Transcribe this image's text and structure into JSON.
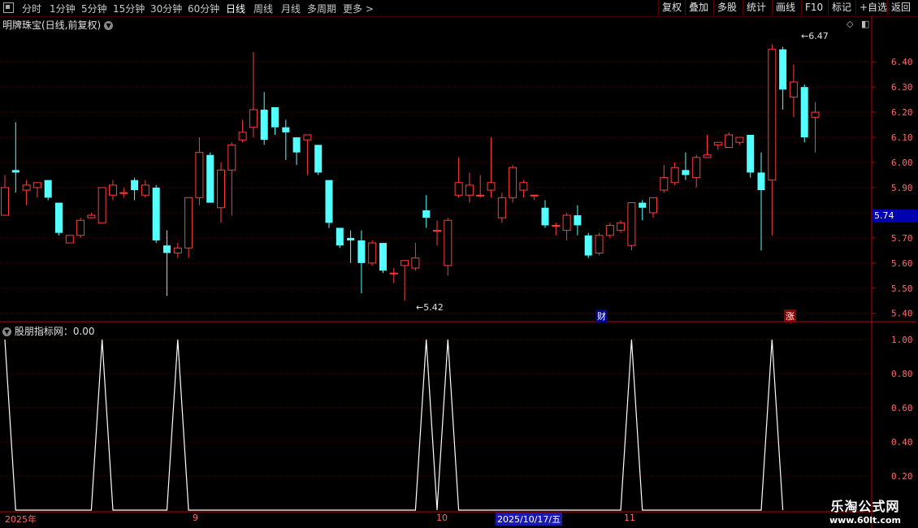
{
  "toolbar": {
    "periods": [
      "分时",
      "1分钟",
      "5分钟",
      "15分钟",
      "30分钟",
      "60分钟",
      "日线",
      "周线",
      "月线",
      "多周期",
      "更多 >"
    ],
    "active_period": "日线",
    "buttons": [
      "复权",
      "叠加",
      "多股",
      "统计",
      "画线",
      "F10",
      "标记",
      "+自选",
      "返回"
    ]
  },
  "main_chart": {
    "title": "明牌珠宝(日线,前复权)",
    "current_price_tag": "5.74",
    "high_annotation": "6.47",
    "low_annotation": "5.42",
    "tags": {
      "cai": "财",
      "zhang": "涨"
    },
    "y_ticks": [
      "6.40",
      "6.30",
      "6.20",
      "6.10",
      "6.00",
      "5.90",
      "5.80",
      "5.70",
      "5.60",
      "5.50",
      "5.40"
    ]
  },
  "indicator": {
    "title": "股朋指标网：0.00",
    "y_ticks": [
      "1.00",
      "0.80",
      "0.60",
      "0.40",
      "0.20"
    ]
  },
  "date_axis": {
    "labels": [
      "2025年",
      "9",
      "10",
      "11"
    ],
    "cursor": "2025/10/17/五"
  },
  "watermark": {
    "line1": "乐淘公式网",
    "line2": "www.60lt.com"
  },
  "colors": {
    "up": "#ff3c3c",
    "down": "#54ffff",
    "grid": "#5a0000",
    "axis": "#c00000"
  },
  "chart_data": {
    "type": "candlestick",
    "ylim": [
      5.37,
      6.53
    ],
    "candles": [
      [
        5.79,
        5.9,
        5.95,
        5.79
      ],
      [
        5.97,
        5.96,
        6.16,
        5.88
      ],
      [
        5.89,
        5.91,
        5.93,
        5.83
      ],
      [
        5.9,
        5.92,
        5.92,
        5.86
      ],
      [
        5.93,
        5.86,
        5.93,
        5.85
      ],
      [
        5.84,
        5.72,
        5.84,
        5.71
      ],
      [
        5.68,
        5.71,
        5.71,
        5.68
      ],
      [
        5.71,
        5.77,
        5.78,
        5.7
      ],
      [
        5.78,
        5.79,
        5.8,
        5.78
      ],
      [
        5.76,
        5.9,
        5.9,
        5.76
      ],
      [
        5.87,
        5.91,
        5.93,
        5.85
      ],
      [
        5.88,
        5.88,
        5.9,
        5.86
      ],
      [
        5.93,
        5.89,
        5.94,
        5.85
      ],
      [
        5.87,
        5.91,
        5.93,
        5.86
      ],
      [
        5.9,
        5.69,
        5.91,
        5.68
      ],
      [
        5.67,
        5.64,
        5.73,
        5.47
      ],
      [
        5.64,
        5.66,
        5.68,
        5.62
      ],
      [
        5.66,
        5.86,
        5.86,
        5.62
      ],
      [
        5.86,
        6.04,
        6.1,
        5.83
      ],
      [
        6.03,
        5.84,
        6.04,
        5.84
      ],
      [
        5.82,
        5.97,
        6.0,
        5.76
      ],
      [
        5.97,
        6.07,
        6.08,
        5.79
      ],
      [
        6.09,
        6.12,
        6.17,
        6.08
      ],
      [
        6.14,
        6.21,
        6.44,
        6.1
      ],
      [
        6.21,
        6.09,
        6.28,
        6.07
      ],
      [
        6.22,
        6.14,
        6.22,
        6.11
      ],
      [
        6.14,
        6.12,
        6.17,
        6.01
      ],
      [
        6.1,
        6.04,
        6.1,
        5.99
      ],
      [
        6.09,
        6.11,
        6.11,
        5.95
      ],
      [
        6.07,
        5.96,
        6.07,
        5.95
      ],
      [
        5.93,
        5.76,
        5.93,
        5.74
      ],
      [
        5.74,
        5.67,
        5.74,
        5.66
      ],
      [
        5.7,
        5.69,
        5.73,
        5.6
      ],
      [
        5.69,
        5.6,
        5.73,
        5.48
      ],
      [
        5.6,
        5.68,
        5.69,
        5.59
      ],
      [
        5.68,
        5.57,
        5.68,
        5.56
      ],
      [
        5.56,
        5.56,
        5.58,
        5.52
      ],
      [
        5.59,
        5.61,
        5.61,
        5.45
      ],
      [
        5.58,
        5.62,
        5.68,
        5.57
      ],
      [
        5.81,
        5.78,
        5.87,
        5.74
      ],
      [
        5.73,
        5.73,
        5.77,
        5.67
      ],
      [
        5.59,
        5.77,
        5.78,
        5.55
      ],
      [
        5.87,
        5.92,
        6.02,
        5.86
      ],
      [
        5.87,
        5.91,
        5.96,
        5.84
      ],
      [
        5.87,
        5.87,
        5.95,
        5.86
      ],
      [
        5.89,
        5.92,
        6.1,
        5.86
      ],
      [
        5.78,
        5.86,
        5.88,
        5.76
      ],
      [
        5.86,
        5.98,
        5.99,
        5.84
      ],
      [
        5.89,
        5.92,
        5.93,
        5.86
      ],
      [
        5.87,
        5.87,
        5.87,
        5.85
      ],
      [
        5.82,
        5.75,
        5.85,
        5.74
      ],
      [
        5.75,
        5.75,
        5.76,
        5.71
      ],
      [
        5.73,
        5.79,
        5.8,
        5.69
      ],
      [
        5.79,
        5.75,
        5.83,
        5.71
      ],
      [
        5.71,
        5.63,
        5.72,
        5.62
      ],
      [
        5.64,
        5.71,
        5.72,
        5.63
      ],
      [
        5.71,
        5.75,
        5.76,
        5.7
      ],
      [
        5.73,
        5.76,
        5.77,
        5.72
      ],
      [
        5.67,
        5.84,
        5.84,
        5.65
      ],
      [
        5.84,
        5.82,
        5.85,
        5.77
      ],
      [
        5.8,
        5.86,
        5.86,
        5.78
      ],
      [
        5.89,
        5.94,
        5.99,
        5.88
      ],
      [
        5.92,
        5.98,
        6.0,
        5.91
      ],
      [
        5.97,
        5.95,
        6.04,
        5.93
      ],
      [
        5.94,
        6.02,
        6.03,
        5.9
      ],
      [
        6.02,
        6.03,
        6.11,
        6.02
      ],
      [
        6.07,
        6.08,
        6.08,
        6.05
      ],
      [
        6.06,
        6.11,
        6.12,
        6.06
      ],
      [
        6.08,
        6.1,
        6.1,
        6.07
      ],
      [
        6.11,
        5.96,
        6.11,
        5.94
      ],
      [
        5.96,
        5.89,
        6.04,
        5.65
      ],
      [
        5.93,
        6.45,
        6.47,
        5.71
      ],
      [
        6.45,
        6.29,
        6.46,
        6.21
      ],
      [
        6.26,
        6.32,
        6.39,
        6.18
      ],
      [
        6.3,
        6.1,
        6.31,
        6.08
      ],
      [
        6.18,
        6.2,
        6.24,
        6.04
      ]
    ],
    "indicator_series": [
      1,
      0,
      0,
      0,
      0,
      0,
      0,
      0,
      0,
      1,
      0,
      0,
      0,
      0,
      0,
      0,
      1,
      0,
      0,
      0,
      0,
      0,
      0,
      0,
      0,
      0,
      0,
      0,
      0,
      0,
      0,
      0,
      0,
      0,
      0,
      0,
      0,
      0,
      0,
      1,
      0,
      1,
      0,
      0,
      0,
      0,
      0,
      0,
      0,
      0,
      0,
      0,
      0,
      0,
      0,
      0,
      0,
      0,
      1,
      0,
      0,
      0,
      0,
      0,
      0,
      0,
      0,
      0,
      0,
      0,
      0,
      1,
      0
    ],
    "indicator_ylim": [
      0,
      1.1
    ]
  }
}
